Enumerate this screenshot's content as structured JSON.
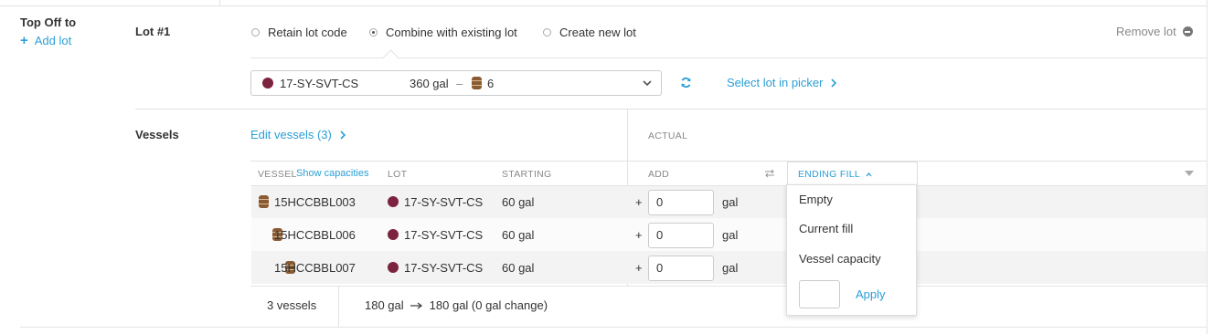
{
  "section": {
    "title": "Top Off to",
    "add_lot": "Add lot"
  },
  "lot": {
    "label": "Lot #1",
    "options": [
      "Retain lot code",
      "Combine with existing lot",
      "Create new lot"
    ],
    "selected_option": "Combine with existing lot",
    "remove": "Remove lot",
    "select": {
      "code": "17-SY-SVT-CS",
      "volume": "360 gal",
      "separator": "–",
      "vessel_count": "6"
    },
    "picker_link": "Select lot in picker"
  },
  "vessels": {
    "label": "Vessels",
    "edit_link": "Edit vessels (3)",
    "actual_header": "ACTUAL",
    "columns": {
      "vessel": "VESSEL",
      "show_capacities": "Show capacities",
      "lot": "LOT",
      "starting": "STARTING",
      "add": "ADD",
      "ending_fill": "ENDING FILL"
    },
    "rows": [
      {
        "vessel": "15HCCBBL003",
        "lot": "17-SY-SVT-CS",
        "starting": "60 gal",
        "plus": "+",
        "add": "0",
        "unit": "gal"
      },
      {
        "vessel": "15HCCBBL006",
        "lot": "17-SY-SVT-CS",
        "starting": "60 gal",
        "plus": "+",
        "add": "0",
        "unit": "gal"
      },
      {
        "vessel": "15HCCBBL007",
        "lot": "17-SY-SVT-CS",
        "starting": "60 gal",
        "plus": "+",
        "add": "0",
        "unit": "gal"
      }
    ],
    "footer": {
      "count": "3 vessels",
      "from": "180 gal",
      "to": "180 gal (0 gal change)"
    }
  },
  "fill_menu": {
    "items": [
      "Empty",
      "Current fill",
      "Vessel capacity"
    ],
    "apply": "Apply"
  },
  "colors": {
    "accent": "#2a9fd6",
    "wine": "#7c2340"
  }
}
